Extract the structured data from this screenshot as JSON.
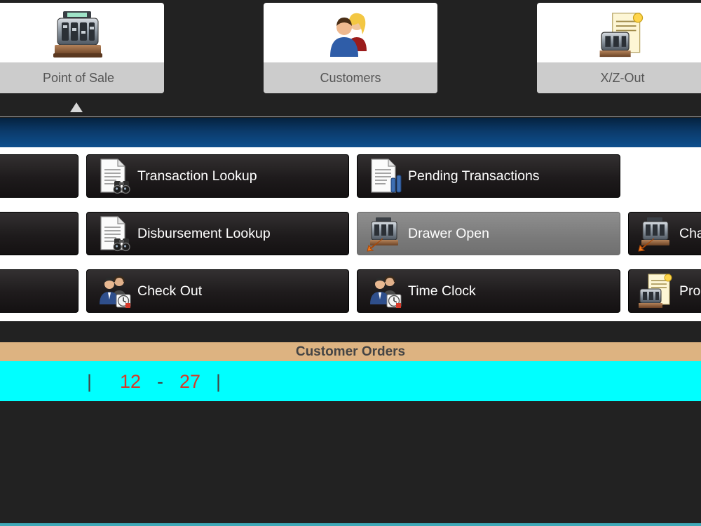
{
  "modules": [
    {
      "label": "Point of Sale",
      "icon": "cash-register-icon",
      "active": true
    },
    {
      "label": "Customers",
      "icon": "customers-icon",
      "active": false
    },
    {
      "label": "X/Z-Out",
      "icon": "register-report-icon",
      "active": false
    }
  ],
  "buttons": {
    "row1": [
      {
        "label": ""
      },
      {
        "label": "Transaction Lookup",
        "icon": "document-binoculars-icon"
      },
      {
        "label": "Pending Transactions",
        "icon": "document-pending-icon"
      }
    ],
    "row2": [
      {
        "label": ""
      },
      {
        "label": "Disbursement Lookup",
        "icon": "document-binoculars-icon"
      },
      {
        "label": "Drawer Open",
        "icon": "cash-drawer-open-icon",
        "disabled": true
      },
      {
        "label": "Cha",
        "icon": "cash-drawer-open-icon"
      }
    ],
    "row3": [
      {
        "label": ""
      },
      {
        "label": "Check Out",
        "icon": "employees-clock-icon"
      },
      {
        "label": "Time Clock",
        "icon": "employees-clock-icon"
      },
      {
        "label": "Pro",
        "icon": "register-document-icon"
      }
    ]
  },
  "customer_orders": {
    "title": "Customer Orders",
    "sep_left": "|",
    "start": "12",
    "dash": "-",
    "end": "27",
    "sep_right": "|"
  },
  "colors": {
    "background": "#222222",
    "orders_header": "#ddb381",
    "orders_bar": "#00ffff",
    "orders_numbers": "#d53a2a"
  }
}
